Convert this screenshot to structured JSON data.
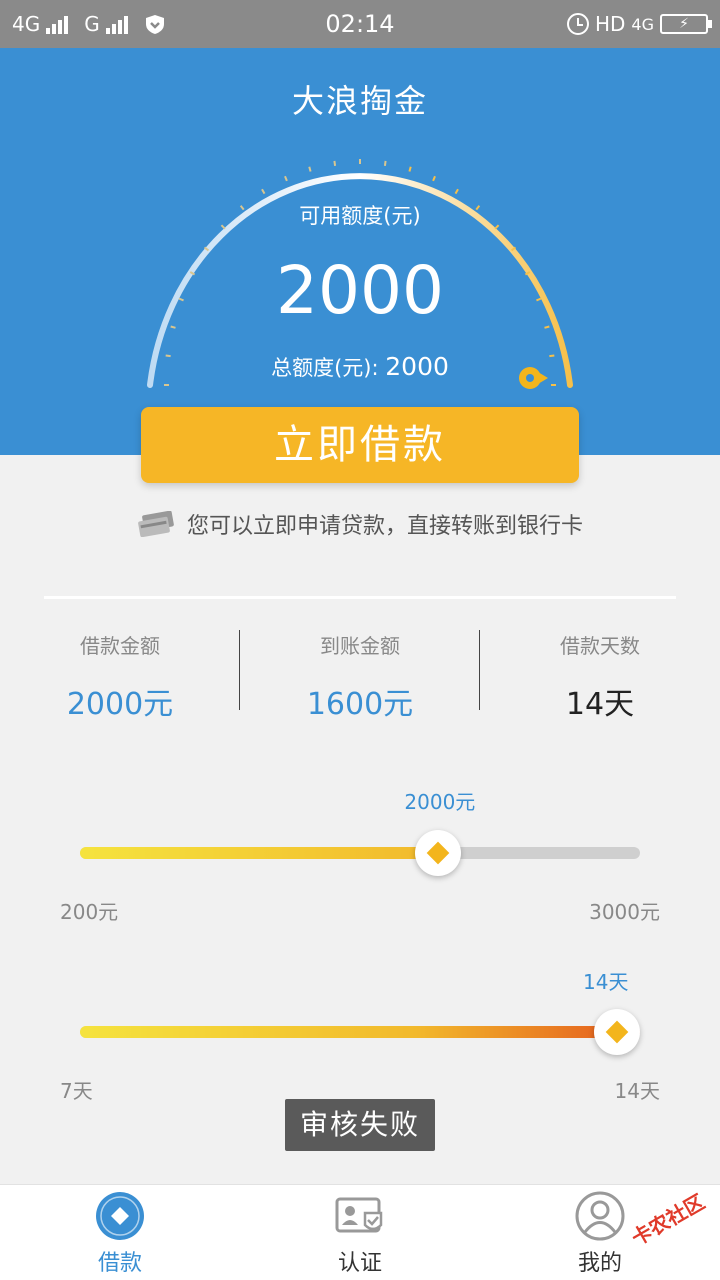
{
  "status_bar": {
    "network1": "4G",
    "network2": "G",
    "time": "02:14",
    "hd": "HD",
    "network3": "4G"
  },
  "header": {
    "title": "大浪掏金",
    "available_label": "可用额度(元)",
    "available_value": "2000",
    "total_label": "总额度(元):",
    "total_value": "2000"
  },
  "borrow_button": {
    "label": "立即借款"
  },
  "hint": {
    "text": "您可以立即申请贷款，直接转账到银行卡"
  },
  "summary": [
    {
      "label": "借款金额",
      "value": "2000元"
    },
    {
      "label": "到账金额",
      "value": "1600元"
    },
    {
      "label": "借款天数",
      "value": "14天"
    }
  ],
  "amount_slider": {
    "current": "2000元",
    "min": "200元",
    "max": "3000元",
    "fraction": 0.64
  },
  "days_slider": {
    "current": "14天",
    "min": "7天",
    "max": "14天",
    "fraction": 1.0
  },
  "toast": {
    "text": "审核失败"
  },
  "tabbar": [
    {
      "label": "借款",
      "icon": "loan-icon",
      "active": true
    },
    {
      "label": "认证",
      "icon": "id-card-icon",
      "active": false
    },
    {
      "label": "我的",
      "icon": "user-icon",
      "active": false
    }
  ],
  "watermark": {
    "text": "卡农社区"
  },
  "colors": {
    "brand_blue": "#3a8fd3",
    "button_orange": "#f6b626"
  }
}
